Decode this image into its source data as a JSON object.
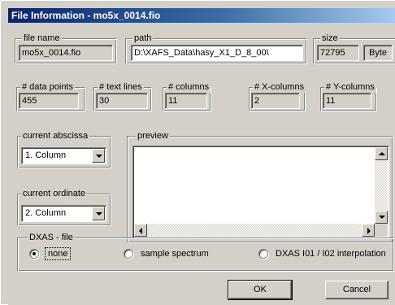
{
  "window": {
    "title": "File Information  - mo5x_0014.fio"
  },
  "file_name": {
    "label": "file name",
    "value": "mo5x_0014.fio"
  },
  "path": {
    "label": "path",
    "value": "D:\\XAFS_Data\\hasy_X1_D_8_00\\"
  },
  "size": {
    "label": "size",
    "value": "72795",
    "unit": "Byte"
  },
  "counts": {
    "data_points": {
      "label": "# data points",
      "value": "455"
    },
    "text_lines": {
      "label": "# text lines",
      "value": "30"
    },
    "columns": {
      "label": "# columns",
      "value": "11"
    },
    "x_columns": {
      "label": "# X-columns",
      "value": "2"
    },
    "y_columns": {
      "label": "# Y-columns",
      "value": "11"
    }
  },
  "abscissa": {
    "label": "current abscissa",
    "selected": "1. Column"
  },
  "ordinate": {
    "label": "current ordinate",
    "selected": "2. Column"
  },
  "preview": {
    "label": "preview",
    "content": ""
  },
  "dxas": {
    "label": "DXAS - file",
    "options": [
      {
        "label": "none",
        "selected": true
      },
      {
        "label": "sample spectrum",
        "selected": false
      },
      {
        "label": "DXAS I01 / I02 interpolation",
        "selected": false
      }
    ]
  },
  "buttons": {
    "ok": "OK",
    "cancel": "Cancel"
  },
  "icons": [
    "dropdown-arrow-icon",
    "scroll-up-arrow-icon",
    "scroll-down-arrow-icon",
    "scroll-left-arrow-icon",
    "scroll-right-arrow-icon"
  ],
  "colors": {
    "title_gradient_start": "#0a246a",
    "title_gradient_end": "#a6caf0",
    "face": "#d4d0c8"
  }
}
